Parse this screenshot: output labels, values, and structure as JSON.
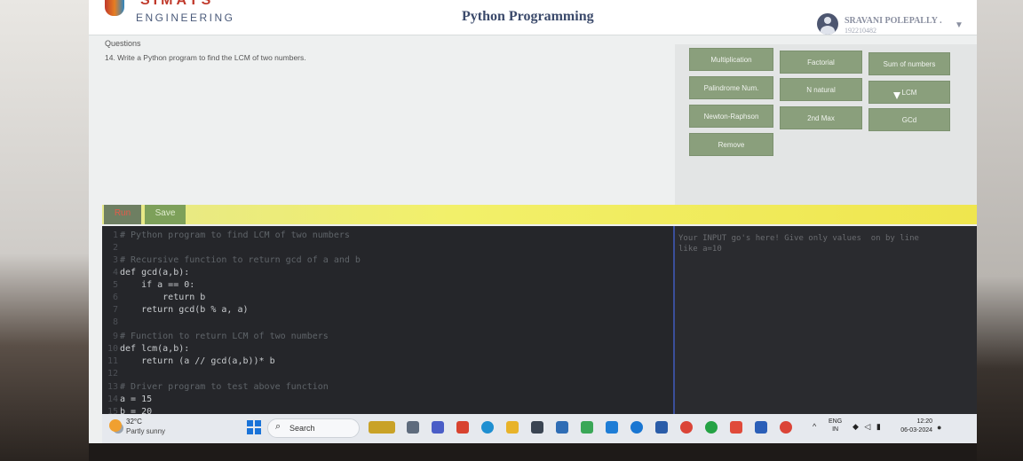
{
  "header": {
    "brand_top": "SIMATS",
    "brand": "ENGINEERING",
    "title": "Python Programming",
    "user_name": "SRAVANI POLEPALLY .",
    "user_id": "192210482",
    "dropdown_glyph": "▼"
  },
  "questions": {
    "label": "Questions",
    "text": "14. Write a Python program to find the LCM of two numbers."
  },
  "program_buttons": [
    "Multiplication",
    "Factorial",
    "Sum of numbers",
    "Palindrome Num.",
    "N natural",
    "LCM",
    "Newton-Raphson",
    "2nd Max",
    "GCd",
    "Remove"
  ],
  "toolbar": {
    "run_label": "Run",
    "save_label": "Save"
  },
  "editor": {
    "lines": [
      {
        "n": "1",
        "text": "# Python program to find LCM of two numbers"
      },
      {
        "n": "2",
        "text": ""
      },
      {
        "n": "3",
        "text": "# Recursive function to return gcd of a and b"
      },
      {
        "n": "4",
        "text": "def gcd(a,b):"
      },
      {
        "n": "5",
        "text": "    if a == 0:"
      },
      {
        "n": "6",
        "text": "        return b"
      },
      {
        "n": "7",
        "text": "    return gcd(b % a, a)"
      },
      {
        "n": "8",
        "text": ""
      },
      {
        "n": "9",
        "text": "# Function to return LCM of two numbers"
      },
      {
        "n": "10",
        "text": "def lcm(a,b):"
      },
      {
        "n": "11",
        "text": "    return (a // gcd(a,b))* b"
      },
      {
        "n": "12",
        "text": ""
      },
      {
        "n": "13",
        "text": "# Driver program to test above function"
      },
      {
        "n": "14",
        "text": "a = 15"
      },
      {
        "n": "15",
        "text": "b = 20"
      }
    ]
  },
  "output": {
    "placeholder": "Your INPUT go's here! Give only values  on by line\nlike a=10"
  },
  "taskbar": {
    "temp": "32°C",
    "weather": "Partly sunny",
    "search_label": "Search",
    "search_glyph": "⌕",
    "lang": "ENG",
    "region": "IN",
    "time": "12:20",
    "date": "06-03-2024",
    "chevron_glyph": "^",
    "tray_glyphs": "◆ ◁ ▮",
    "notif_glyph": "●"
  },
  "colors": {
    "button_green": "#8a9f7c",
    "toolbar_yellow": "#f2f06a",
    "editor_bg": "#25262a",
    "title_navy": "#3b4a6b"
  }
}
